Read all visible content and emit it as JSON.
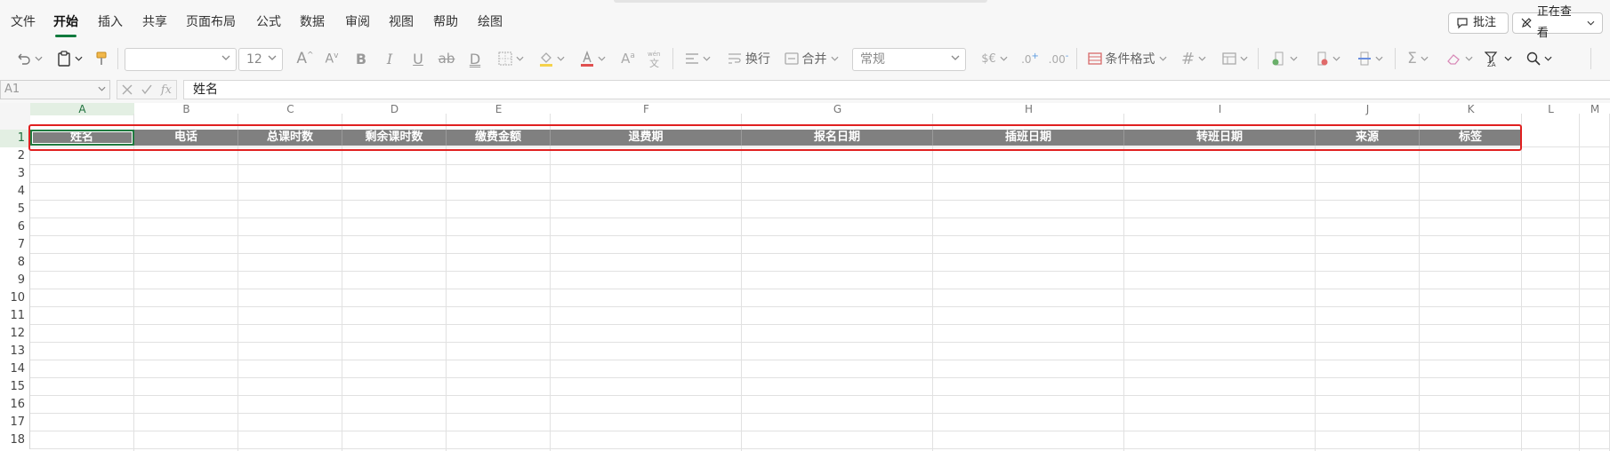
{
  "menu": {
    "items": [
      "文件",
      "开始",
      "插入",
      "共享",
      "页面布局",
      "公式",
      "数据",
      "审阅",
      "视图",
      "帮助",
      "绘图"
    ],
    "active": "开始",
    "comment_button": "批注",
    "view_mode_button": "正在查看"
  },
  "toolbar": {
    "font_name": "",
    "font_size": "12",
    "wrap_label": "换行",
    "merge_label": "合并",
    "number_format": "常规",
    "conditional_format_label": "条件格式"
  },
  "formula_bar": {
    "name_box": "A1",
    "formula": "姓名"
  },
  "sheet": {
    "columns": [
      "A",
      "B",
      "C",
      "D",
      "E",
      "F",
      "G",
      "H",
      "I",
      "J",
      "K",
      "L",
      "M"
    ],
    "rows": [
      "1",
      "2",
      "3",
      "4",
      "5",
      "6",
      "7",
      "8",
      "9",
      "10",
      "11",
      "12",
      "13",
      "14",
      "15",
      "16",
      "17",
      "18"
    ],
    "header_values": [
      "姓名",
      "电话",
      "总课时数",
      "剩余课时数",
      "缴费金额",
      "退费期",
      "报名日期",
      "插班日期",
      "转班日期",
      "来源",
      "标签"
    ],
    "selected_cell": "A1",
    "header_fill": "#808080",
    "highlight_color": "#e02020",
    "accent": "#1f7a3f"
  }
}
